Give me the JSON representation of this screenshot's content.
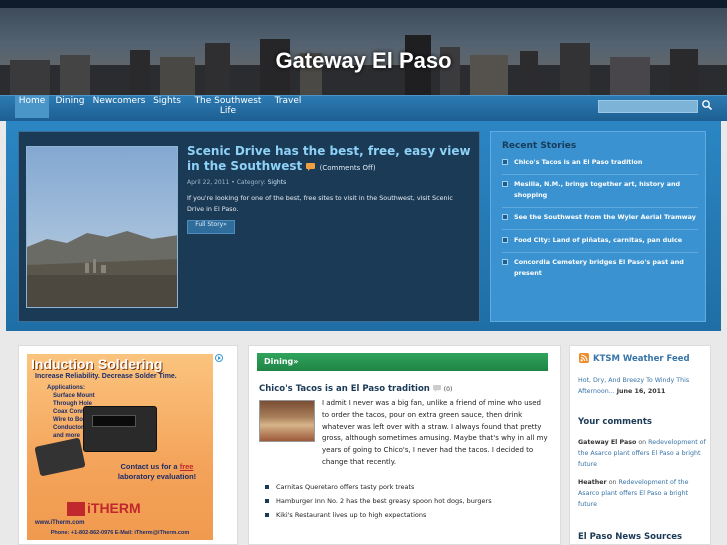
{
  "header": {
    "site_title": "Gateway El Paso"
  },
  "nav": {
    "items": [
      {
        "label": "Home",
        "active": true
      },
      {
        "label": "Dining"
      },
      {
        "label": "Newcomers"
      },
      {
        "label": "Sights"
      },
      {
        "label": "The Southwest Life"
      },
      {
        "label": "Travel"
      }
    ],
    "search_placeholder": "",
    "search_icon": "search-icon"
  },
  "feature": {
    "title": "Scenic Drive has the best, free, easy view in the Southwest",
    "comments": "(Comments Off)",
    "date": "April 22, 2011",
    "category_prefix": "Category:",
    "category": "Sights",
    "excerpt": "If you're looking for one of the best, free sites to visit in the Southwest, visit Scenic Drive in El Paso.",
    "button_label": "Full Story»"
  },
  "recent": {
    "heading": "Recent Stories",
    "items": [
      "Chico's Tacos is an El Paso tradition",
      "Mesilla, N.M., brings together art, history and shopping",
      "See the Southwest from the Wyler Aerial Tramway",
      "Food City: Land of piñatas, carnitas, pan dulce",
      "Concordia Cemetery bridges El Paso's past and present"
    ]
  },
  "ad": {
    "title": "Induction Soldering",
    "subtitle": "Increase Reliability. Decrease Solder Time.",
    "applications_heading": "Applications:",
    "applications": [
      "Surface Mount",
      "Through Hole",
      "Coax Connector",
      "Wire to Board",
      "Conductor to Wafer",
      "and more"
    ],
    "contact_line1": "Contact us for a",
    "contact_free": "free",
    "contact_line2": "laboratory evaluation!",
    "logo": "iTHERM",
    "web": "www.iTherm.com",
    "phone": "Phone: +1-802-862-0976    E-Mail: iTherm@iTherm.com"
  },
  "dining": {
    "bar_label": "Dining»",
    "post_title": "Chico's Tacos is an El Paso tradition",
    "comment_count": "(0)",
    "excerpt": "I admit I never was a big fan, unlike a friend of mine who used to order the tacos, pour on extra green sauce, then drink whatever was left over with a straw. I always found that pretty gross, although sometimes amusing. Maybe that's why in all my years of going to Chico's, I never had the tacos. I decided to change that recently.",
    "list": [
      "Carnitas Queretaro offers tasty pork treats",
      "Hamburger Inn No. 2 has the best greasy spoon hot dogs, burgers",
      "Kiki's Restaurant lives up to high expectations"
    ]
  },
  "sidebar": {
    "weather_heading": "KTSM Weather Feed",
    "weather_text": "Hot, Dry, And Breezy To Windy This Afternoon...",
    "weather_date": "June 16, 2011",
    "comments_heading": "Your comments",
    "comments": [
      {
        "author": "Gateway El Paso",
        "on": "on",
        "post": "Redevelopment of the Asarco plant offers El Paso a bright future"
      },
      {
        "author": "Heather",
        "on": "on",
        "post": "Redevelopment of the Asarco plant offers El Paso a bright future"
      }
    ],
    "news_heading": "El Paso News Sources"
  }
}
